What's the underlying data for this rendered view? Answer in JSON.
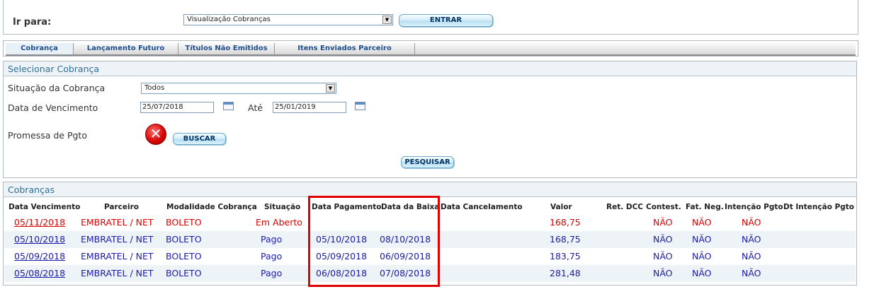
{
  "goto": {
    "label": "Ir para:",
    "select_value": "Visualização Cobranças",
    "enter_button": "ENTRAR"
  },
  "tabs": [
    {
      "label": "Cobrança"
    },
    {
      "label": "Lançamento Futuro"
    },
    {
      "label": "Títulos Não Emitidos"
    },
    {
      "label": "Itens Enviados Parceiro"
    }
  ],
  "filter": {
    "title": "Selecionar Cobrança",
    "situacao_label": "Situação da Cobrança",
    "situacao_value": "Todos",
    "vencimento_label": "Data de Vencimento",
    "date_from": "25/07/2018",
    "ate_label": "Até",
    "date_to": "25/01/2019",
    "promessa_label": "Promessa de Pgto",
    "buscar_button": "BUSCAR",
    "pesquisar_button": "PESQUISAR"
  },
  "cobrancas": {
    "title": "Cobranças",
    "columns": [
      "Data Vencimento",
      "Parceiro",
      "Modalidade Cobrança",
      "Situação",
      "Data Pagamento",
      "Data da Baixa",
      "Data Cancelamento",
      "Valor",
      "Ret. DCC",
      "Contest.",
      "Fat. Neg.",
      "Intenção Pgto",
      "Dt Intenção Pgto"
    ],
    "rows": [
      {
        "vencimento": "05/11/2018",
        "parceiro": "EMBRATEL / NET",
        "modalidade": "BOLETO",
        "situacao": "Em Aberto",
        "pagamento": "",
        "baixa": "",
        "cancelamento": "",
        "valor": "168,75",
        "ret_dcc": "",
        "contest": "NÃO",
        "fat_neg": "NÃO",
        "intencao": "NÃO",
        "dt_intencao": ""
      },
      {
        "vencimento": "05/10/2018",
        "parceiro": "EMBRATEL / NET",
        "modalidade": "BOLETO",
        "situacao": "Pago",
        "pagamento": "05/10/2018",
        "baixa": "08/10/2018",
        "cancelamento": "",
        "valor": "168,75",
        "ret_dcc": "",
        "contest": "NÃO",
        "fat_neg": "NÃO",
        "intencao": "NÃO",
        "dt_intencao": ""
      },
      {
        "vencimento": "05/09/2018",
        "parceiro": "EMBRATEL / NET",
        "modalidade": "BOLETO",
        "situacao": "Pago",
        "pagamento": "05/09/2018",
        "baixa": "06/09/2018",
        "cancelamento": "",
        "valor": "183,75",
        "ret_dcc": "",
        "contest": "NÃO",
        "fat_neg": "NÃO",
        "intencao": "NÃO",
        "dt_intencao": ""
      },
      {
        "vencimento": "05/08/2018",
        "parceiro": "EMBRATEL / NET",
        "modalidade": "BOLETO",
        "situacao": "Pago",
        "pagamento": "06/08/2018",
        "baixa": "07/08/2018",
        "cancelamento": "",
        "valor": "281,48",
        "ret_dcc": "",
        "contest": "NÃO",
        "fat_neg": "NÃO",
        "intencao": "NÃO",
        "dt_intencao": ""
      }
    ]
  },
  "colors": {
    "overdue": "#d80000",
    "paid": "#1a1aa6",
    "section_title": "#2e6f98",
    "highlight": "#e00000"
  }
}
